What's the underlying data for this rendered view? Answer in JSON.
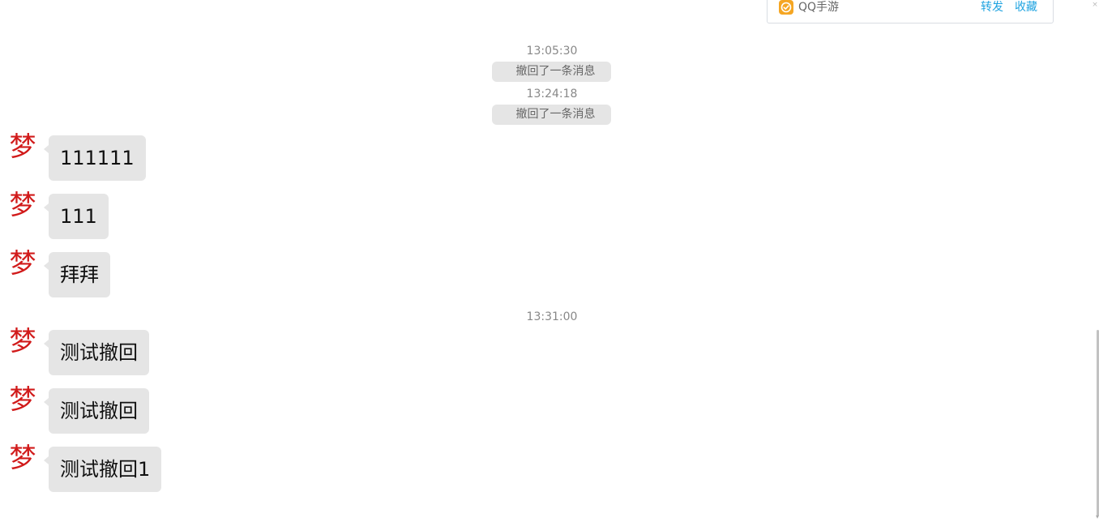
{
  "share_card": {
    "app_name": "QQ手游",
    "forward_label": "转发",
    "favorite_label": "收藏",
    "app_icon": "qq-game-check-icon",
    "accent_color": "#1fa3e0",
    "icon_color": "#f5a623"
  },
  "corner_close": "×",
  "timeline": {
    "time_1": "13:05:30",
    "notice_1": "撤回了一条消息",
    "time_2": "13:24:18",
    "notice_2": "撤回了一条消息",
    "time_3": "13:31:00"
  },
  "sender": {
    "avatar_char": "梦",
    "avatar_color": "#d11a1a"
  },
  "messages": [
    {
      "text": "111111"
    },
    {
      "text": "111"
    },
    {
      "text": "拜拜"
    },
    {
      "text": "测试撤回"
    },
    {
      "text": "测试撤回"
    },
    {
      "text": "测试撤回1"
    }
  ],
  "colors": {
    "bubble_bg": "#e5e5e5",
    "timestamp_text": "#888888"
  }
}
